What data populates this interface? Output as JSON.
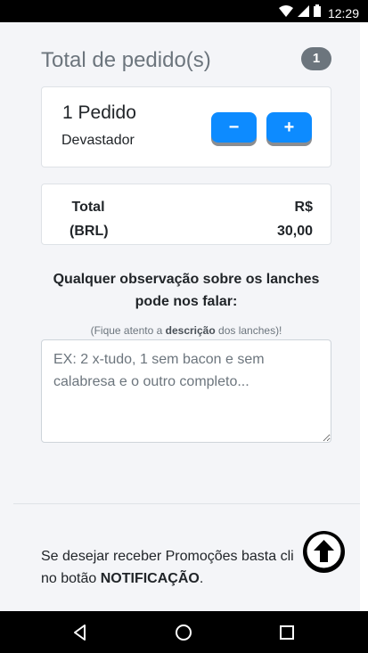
{
  "status_bar": {
    "time": "12:29",
    "icons": [
      "wifi-icon",
      "signal-icon",
      "battery-icon"
    ]
  },
  "orders": {
    "title": "Total de pedido(s)",
    "count": "1",
    "items": [
      {
        "quantity_label": "1 Pedido",
        "name": "Devastador",
        "decrease_label": "−",
        "increase_label": "+"
      }
    ]
  },
  "total": {
    "label_line1": "Total",
    "label_line2": "(BRL)",
    "currency": "R$",
    "amount": "30,00"
  },
  "observation": {
    "title_line1": "Qualquer observação sobre os lanches",
    "title_line2": "pode nos falar:",
    "hint_prefix": "(Fique atento a ",
    "hint_bold": "descrição",
    "hint_suffix": " dos lanches)!",
    "placeholder": "EX: 2 x-tudo, 1 sem bacon e sem calabresa e o outro completo...",
    "value": ""
  },
  "promo": {
    "line1": "Se desejar receber Promoções basta cli",
    "line2_prefix": "no botão ",
    "line2_bold": "NOTIFICAÇÃO",
    "line2_suffix": "."
  },
  "colors": {
    "accent": "#0d8bff",
    "badge": "#6c757d",
    "background": "#f4f5f8"
  },
  "nav_bar": {
    "buttons": [
      "back-icon",
      "home-icon",
      "recents-icon"
    ]
  }
}
